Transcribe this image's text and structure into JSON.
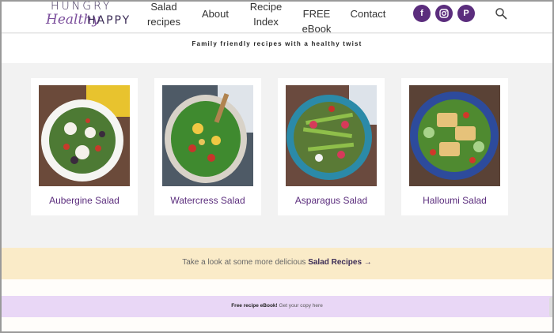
{
  "header": {
    "logo": {
      "line1": "HUNGRY",
      "line2": "Healthy",
      "line3": "HAPPY"
    },
    "nav": [
      {
        "label_line1": "Salad",
        "label_line2": "recipes"
      },
      {
        "label_line1": "About",
        "label_line2": ""
      },
      {
        "label_line1": "Recipe",
        "label_line2": "Index"
      },
      {
        "label_line1": "FREE eBook",
        "label_line2": ""
      },
      {
        "label_line1": "Contact",
        "label_line2": ""
      }
    ],
    "social": [
      {
        "icon": "facebook-icon",
        "glyph": "f"
      },
      {
        "icon": "instagram-icon",
        "glyph": "◎"
      },
      {
        "icon": "pinterest-icon",
        "glyph": "P"
      }
    ],
    "accent": "#5b2d7d"
  },
  "tagline": "Family friendly recipes with a healthy twist",
  "recipes": [
    {
      "title": "Aubergine Salad"
    },
    {
      "title": "Watercress Salad"
    },
    {
      "title": "Asparagus Salad"
    },
    {
      "title": "Halloumi Salad"
    }
  ],
  "cta": {
    "text": "Take a look at some more delicious ",
    "link": "Salad Recipes →"
  },
  "ebook": {
    "strong": "Free recipe eBook!",
    "text": " Get your copy here"
  },
  "colors": {
    "cta_bg": "#faebc8",
    "ebook_bg": "#e9d7f6"
  }
}
